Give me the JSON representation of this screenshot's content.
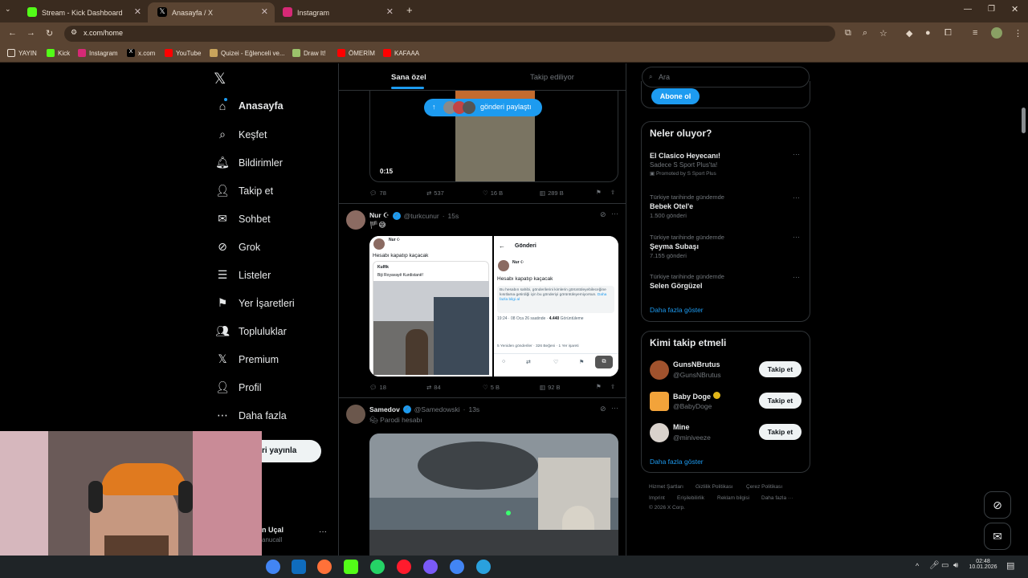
{
  "browser": {
    "tabs": [
      {
        "label": "Stream - Kick Dashboard",
        "favicon_color": "#53fc18"
      },
      {
        "label": "Anasayfa / X",
        "favicon_color": "#000000"
      },
      {
        "label": "Instagram",
        "favicon_color": "#d62976"
      }
    ],
    "url": "x.com/home",
    "bookmarks": [
      "YAYIN",
      "Kick",
      "Instagram",
      "x.com",
      "YouTube",
      "Quizei - Eğlenceli ve...",
      "Draw It!",
      "ÖMERİM",
      "KAFAAA"
    ]
  },
  "sidebar": {
    "items": [
      {
        "label": "Anasayfa",
        "icon": "home-icon"
      },
      {
        "label": "Keşfet",
        "icon": "search-icon"
      },
      {
        "label": "Bildirimler",
        "icon": "bell-icon"
      },
      {
        "label": "Takip et",
        "icon": "add-user-icon"
      },
      {
        "label": "Sohbet",
        "icon": "mail-icon"
      },
      {
        "label": "Grok",
        "icon": "grok-icon"
      },
      {
        "label": "Listeler",
        "icon": "list-icon"
      },
      {
        "label": "Yer İşaretleri",
        "icon": "bookmark-icon"
      },
      {
        "label": "Topluluklar",
        "icon": "communities-icon"
      },
      {
        "label": "Premium",
        "icon": "x-logo-icon"
      },
      {
        "label": "Profil",
        "icon": "profile-icon"
      },
      {
        "label": "Daha fazla",
        "icon": "more-icon"
      }
    ],
    "post_button": "ri yayınla",
    "account_name": "n Uçal",
    "account_handle": "anucall"
  },
  "feed": {
    "tabs": [
      "Sana özel",
      "Takip ediliyor"
    ],
    "toast": "gönderi paylaştı",
    "posts": [
      {
        "video_time": "0:15",
        "stats": {
          "replies": "78",
          "reposts": "537",
          "likes": "16 B",
          "views": "289 B"
        }
      },
      {
        "name": "Nur ☪",
        "handle": "@turkcunur",
        "time": "15s",
        "text": "🏴😅",
        "embedded": {
          "left_title": "Hesabı kapatıp kaçacak",
          "left_quoted_name": "Kulfik",
          "left_quoted_text": "Biji Royavayê Kurdistanê!",
          "right_header": "Gönderi",
          "right_title": "Hesabı kapatıp kaçacak",
          "right_notice": "Bu hesabın sahibi, gönderilerini kimlerin görüntüleyebileceğine kısıtlama getirdiği için bu gönderiyi görüntüleyemiyorsun.",
          "right_notice_link": "Daha fazla bilgi al",
          "right_date": "19:24 · 08 Oca 26 saatinde · ",
          "right_views": "4.440",
          "right_views_label": "Görüntüleme",
          "right_reposts_line": "5 Yeniden gönderiler · 326 Beğeni · 1 Yer işareti"
        },
        "stats": {
          "replies": "18",
          "reposts": "84",
          "likes": "5 B",
          "views": "92 B"
        }
      },
      {
        "name": "Samedov",
        "handle": "@Samedowski",
        "time": "13s",
        "text": "Parodi hesabı"
      }
    ]
  },
  "right": {
    "search_placeholder": "Ara",
    "subscribe": "Abone ol",
    "trends_title": "Neler oluyor?",
    "trends": [
      {
        "top": "",
        "name": "El Clasico Heyecanı!",
        "sub": "Sadece S Sport Plus'ta!",
        "promoted": "Promoted by S Sport Plus"
      },
      {
        "top": "Türkiye tarihinde gündemde",
        "name": "Bebek Otel'e",
        "sub": "1.500 gönderi"
      },
      {
        "top": "Türkiye tarihinde gündemde",
        "name": "Şeyma Subaşı",
        "sub": "7.155 gönderi"
      },
      {
        "top": "Türkiye tarihinde gündemde",
        "name": "Selen Görgüzel",
        "sub": ""
      }
    ],
    "show_more": "Daha fazla göster",
    "who_to_follow": "Kimi takip etmeli",
    "suggestions": [
      {
        "name": "GunsNBrutus",
        "handle": "@GunsNBrutus",
        "button": "Takip et"
      },
      {
        "name": "Baby Doge",
        "handle": "@BabyDoge",
        "button": "Takip et"
      },
      {
        "name": "Mine",
        "handle": "@miniveeze",
        "button": "Takip et"
      }
    ],
    "footer": [
      "Hizmet Şartları",
      "Gizlilik Politikası",
      "Çerez Politikası",
      "Imprint",
      "Erişilebilirlik",
      "Reklam bilgisi",
      "Daha fazla ···",
      "© 2026 X Corp."
    ]
  },
  "taskbar": {
    "time": "02:48",
    "date": "10.01.2026"
  }
}
